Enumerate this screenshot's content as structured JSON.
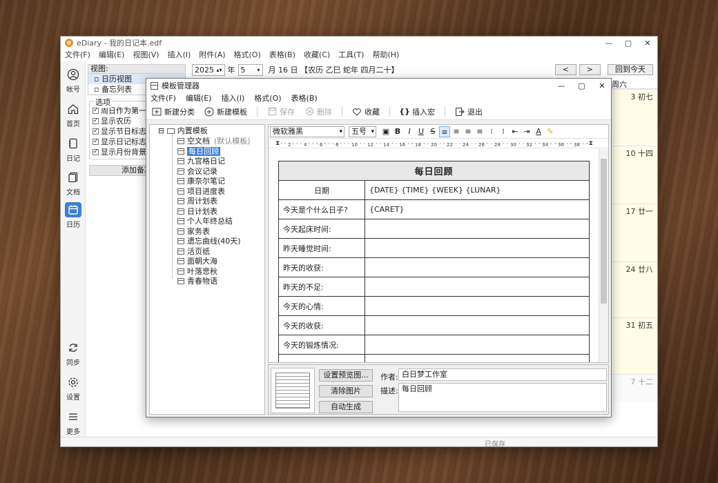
{
  "window": {
    "title": "eDiary - 我的日记本.edf",
    "controls": [
      "—",
      "▢",
      "✕"
    ]
  },
  "menubar": [
    "文件(F)",
    "编辑(E)",
    "视图(V)",
    "插入(I)",
    "附件(A)",
    "格式(O)",
    "表格(B)",
    "收藏(C)",
    "工具(T)",
    "帮助(H)"
  ],
  "rail": {
    "items": [
      {
        "label": "帐号",
        "icon": "account-icon"
      },
      {
        "label": "首页",
        "icon": "home-icon"
      },
      {
        "label": "日记",
        "icon": "diary-icon"
      },
      {
        "label": "文档",
        "icon": "document-icon"
      },
      {
        "label": "日历",
        "icon": "calendar-icon"
      },
      {
        "label": "同步",
        "icon": "sync-icon"
      },
      {
        "label": "设置",
        "icon": "gear-icon"
      },
      {
        "label": "更多",
        "icon": "menu-icon"
      }
    ]
  },
  "side_panel": {
    "view_header": "视图:",
    "views": [
      "日历视图",
      "备忘列表"
    ],
    "options_title": "选项",
    "options": [
      "周日作为第一天",
      "显示农历",
      "显示节日标志",
      "显示日记标志",
      "显示月份背景水印"
    ],
    "add_memo": "添加备忘"
  },
  "calendar": {
    "year": "2025",
    "year_unit": "年",
    "month": "5",
    "month_unit": "月",
    "date_info": "月 16 日 【农历 乙巳 蛇年 四月二十】",
    "prev": "<",
    "next": ">",
    "today_btn": "回到今天",
    "weekday_last": "周六",
    "cells": [
      {
        "num": "3 初七"
      },
      {
        "num": "10 十四"
      },
      {
        "num": "17 廿一"
      },
      {
        "num": "24 廿八"
      },
      {
        "num": "31 初五"
      },
      {
        "num": "7 十二"
      }
    ]
  },
  "status": {
    "saved": "已保存"
  },
  "dialog": {
    "title": "模板管理器",
    "controls": [
      "—",
      "▢",
      "✕"
    ],
    "menu": [
      "文件(F)",
      "编辑(E)",
      "插入(I)",
      "格式(O)",
      "表格(B)"
    ],
    "toolbar": {
      "new_category": "新建分类",
      "new_template": "新建模板",
      "save": "保存",
      "delete": "删除",
      "favorite": "收藏",
      "insert_macro": "插入宏",
      "exit": "退出"
    },
    "tree": {
      "root": "内置模板",
      "default_hint": "(默认模板)",
      "items": [
        "空文档",
        "每日回顾",
        "九宫格日记",
        "会议记录",
        "康奈尔笔记",
        "项目进度表",
        "周计划表",
        "日计划表",
        "个人年终总结",
        "家务表",
        "遗忘曲线(40天)",
        "活页纸",
        "面朝大海",
        "叶落悲秋",
        "青春物语"
      ],
      "selected_index": 1
    },
    "editor": {
      "font": "微软雅黑",
      "size": "五号",
      "ruler": [
        "2",
        "4",
        "6",
        "8",
        "10",
        "12",
        "14",
        "16",
        "18",
        "20",
        "22",
        "24",
        "26",
        "28",
        "30",
        "32",
        "34",
        "36",
        "38"
      ],
      "table": {
        "title": "每日回顾",
        "rows": [
          {
            "label": "日期",
            "value": "{DATE} {TIME} {WEEK} {LUNAR}",
            "center": true
          },
          {
            "label": "今天是个什么日子?",
            "value": "{CARET}",
            "center": false
          },
          {
            "label": "今天起床时间:",
            "value": "",
            "center": false
          },
          {
            "label": "昨天睡觉时间:",
            "value": "",
            "center": false
          },
          {
            "label": "昨天的收获:",
            "value": "",
            "center": false
          },
          {
            "label": "昨天的不足:",
            "value": "",
            "center": false
          },
          {
            "label": "今天的心情:",
            "value": "",
            "center": false
          },
          {
            "label": "今天的收获:",
            "value": "",
            "center": false
          },
          {
            "label": "今天的锻炼情况:",
            "value": "",
            "center": false
          }
        ]
      }
    },
    "bottom": {
      "set_preview": "设置预览图...",
      "clear_image": "清除图片",
      "auto_generate": "自动生成",
      "author_label": "作者:",
      "author_value": "白日梦工作室",
      "desc_label": "描述:",
      "desc_value": "每日回顾"
    }
  }
}
